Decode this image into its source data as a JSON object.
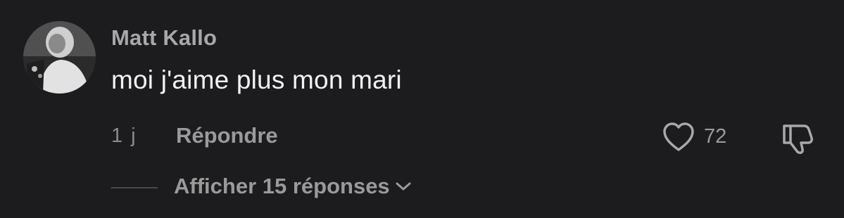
{
  "comment": {
    "username": "Matt Kallo",
    "text": "moi j'aime plus mon mari",
    "time": "1 j",
    "reply_label": "Répondre",
    "like_count": "72",
    "view_replies_label": "Afficher 15 réponses"
  },
  "icons": {
    "like": "heart-icon",
    "dislike": "thumbs-down-icon",
    "chevron": "chevron-down-icon"
  },
  "colors": {
    "background": "#1c1c1e",
    "username": "#a8a8a8",
    "text": "#f2f2f2",
    "meta": "#9a9a9a"
  }
}
